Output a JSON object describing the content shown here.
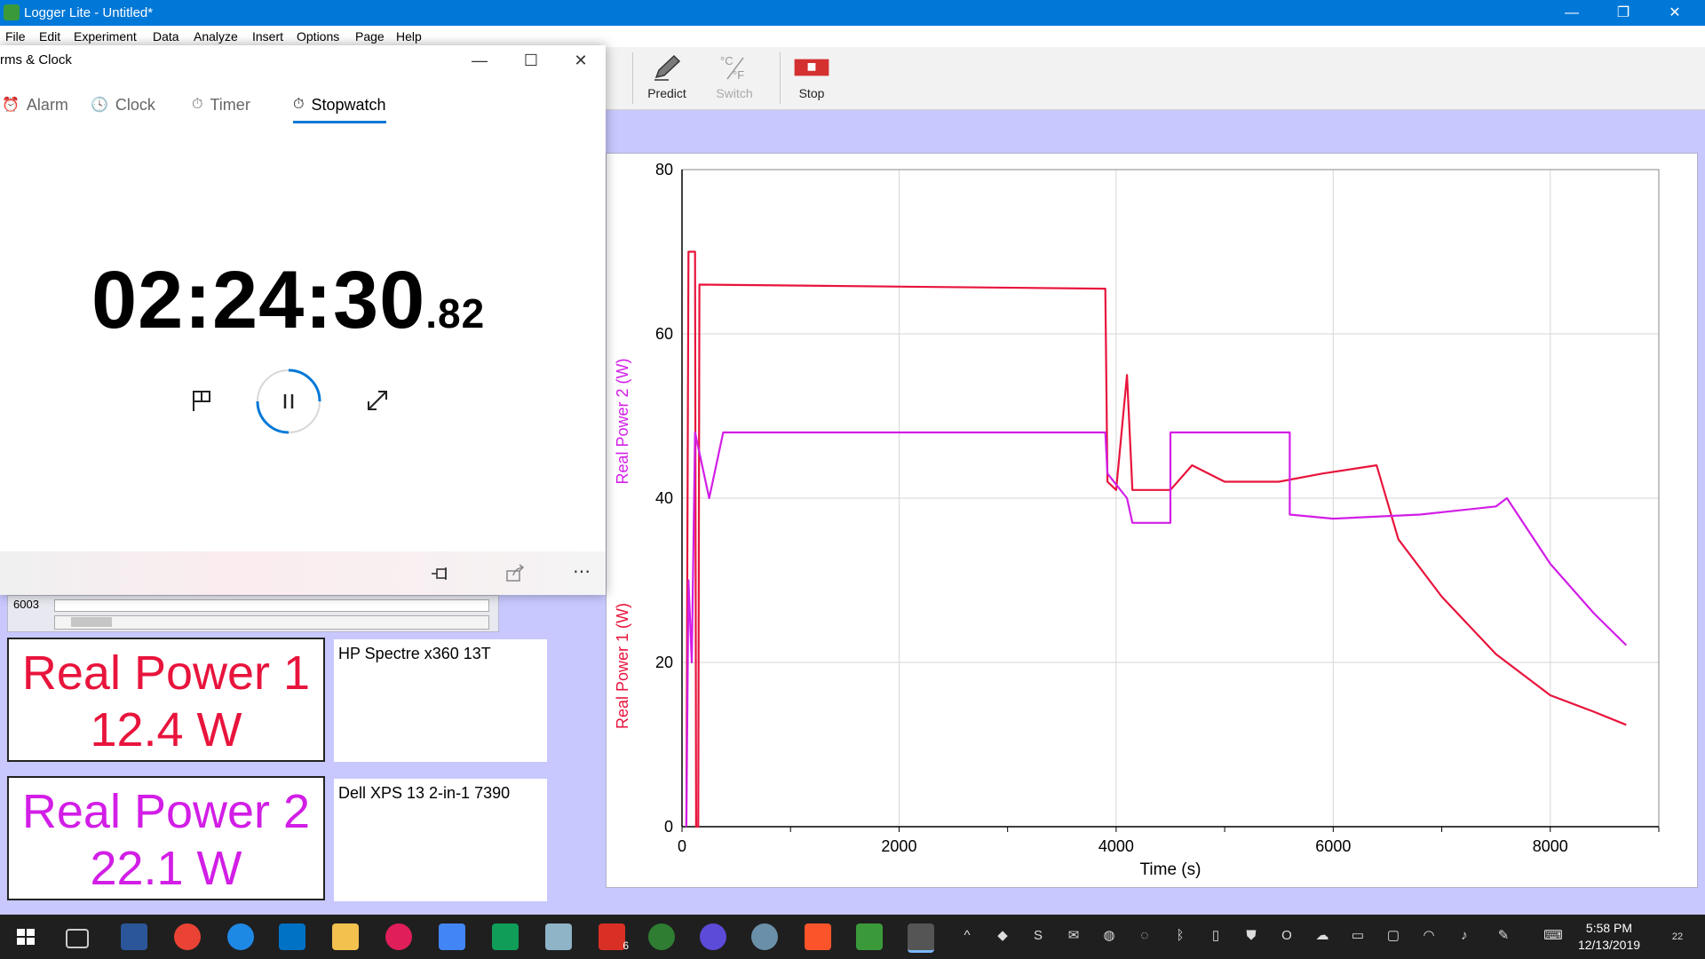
{
  "window": {
    "title": "Logger Lite - Untitled*"
  },
  "menu": [
    "File",
    "Edit",
    "Experiment",
    "Data",
    "Analyze",
    "Insert",
    "Options",
    "Page",
    "Help"
  ],
  "toolbar": {
    "predict": "Predict",
    "switch": "Switch",
    "stop": "Stop"
  },
  "alarms_clock": {
    "title": "rms & Clock",
    "tabs": [
      "Alarm",
      "Clock",
      "Timer",
      "Stopwatch"
    ],
    "active_tab": "Stopwatch",
    "time_main": "02:24:30",
    "time_centis": ".82"
  },
  "meters": [
    {
      "name": "Real Power 1",
      "value": "12.4 W",
      "color": "#e8143c",
      "device": "HP Spectre x360 13T"
    },
    {
      "name": "Real Power 2",
      "value": "22.1 W",
      "color": "#d21ee6",
      "device": "Dell XPS 13 2-in-1 7390"
    }
  ],
  "table_fragment": "6003",
  "chart_data": {
    "type": "line",
    "xlabel": "Time (s)",
    "ylabel_series1": "Real Power 1 (W)",
    "ylabel_series2": "Real Power 2 (W)",
    "xlim": [
      0,
      9000
    ],
    "ylim": [
      0,
      80
    ],
    "x_ticks": [
      0,
      2000,
      4000,
      6000,
      8000
    ],
    "y_ticks": [
      0,
      20,
      40,
      60,
      80
    ],
    "grid": true,
    "series": [
      {
        "name": "Real Power 1 (W)",
        "color": "#e8143c",
        "points": [
          [
            40,
            0
          ],
          [
            60,
            70
          ],
          [
            120,
            70
          ],
          [
            130,
            0
          ],
          [
            150,
            0
          ],
          [
            160,
            66
          ],
          [
            3900,
            65.5
          ],
          [
            3920,
            42
          ],
          [
            4000,
            41
          ],
          [
            4100,
            55
          ],
          [
            4150,
            41
          ],
          [
            4500,
            41
          ],
          [
            4700,
            44
          ],
          [
            5000,
            42
          ],
          [
            5500,
            42
          ],
          [
            5900,
            43
          ],
          [
            6400,
            44
          ],
          [
            6600,
            35
          ],
          [
            7000,
            28
          ],
          [
            7500,
            21
          ],
          [
            8000,
            16
          ],
          [
            8400,
            14
          ],
          [
            8700,
            12.4
          ]
        ]
      },
      {
        "name": "Real Power 2 (W)",
        "color": "#d21ee6",
        "points": [
          [
            40,
            0
          ],
          [
            60,
            30
          ],
          [
            90,
            20
          ],
          [
            120,
            48
          ],
          [
            250,
            40
          ],
          [
            380,
            48
          ],
          [
            3900,
            48
          ],
          [
            3920,
            43
          ],
          [
            4100,
            40
          ],
          [
            4150,
            37
          ],
          [
            4500,
            37
          ],
          [
            4500,
            48
          ],
          [
            5600,
            48
          ],
          [
            5600,
            38
          ],
          [
            6000,
            37.5
          ],
          [
            6800,
            38
          ],
          [
            7500,
            39
          ],
          [
            7600,
            40
          ],
          [
            8000,
            32
          ],
          [
            8400,
            26
          ],
          [
            8700,
            22.1
          ]
        ]
      }
    ]
  },
  "taskbar": {
    "time": "5:58 PM",
    "date": "12/13/2019",
    "badge_count": "6",
    "notify_count": "22"
  }
}
